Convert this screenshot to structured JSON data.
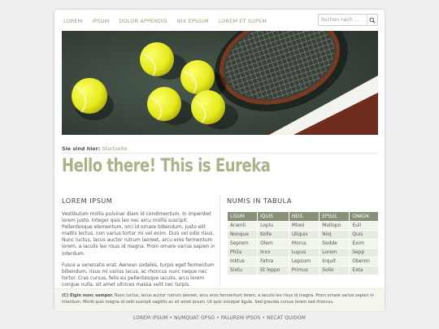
{
  "nav": {
    "items": [
      "LOREM",
      "IPSUM",
      "DOLOR APPENDIS",
      "NIX EPSIUM",
      "LOREM ET SUPEM"
    ]
  },
  "search": {
    "placeholder": "Suchen nach ..."
  },
  "breadcrumb": {
    "prefix": "Sie sind hier:",
    "current": "Startseite"
  },
  "headline": "Hello there! This is Eureka",
  "left": {
    "title": "LOREM IPSUM",
    "paragraphs": [
      "Vestibulum mollis pulvinar diam id condimentum. In imperdiet lorem justo. Integer quis leo nec arcu mollis suscipit. Pellentesque elementum, orci id ornare bibendum, justo elit mattis lectus, non varius tortor mi vel enim. Duis vel odio risus. Nunc luctus, lacus auctor rutrum laoreet, arcu eros fermentum lorem, a iaculis leo risus id magna. Proin ornare varius sapien in interdum.",
      "Fusce a venenatis erat. Aenean sodales, turpis eget fermentum bibendum, risus mi varius lacus, ac rhoncus nunc neque nec tortor. Cras cursus, felis eu pellentesque iaculis, arcu lorem congue nulla, sit amet ultrices massa velit nec turpis."
    ]
  },
  "right": {
    "title": "NUMIS IN TABULA",
    "headers": [
      "LISUM",
      "IQUIS",
      "NEIS",
      "EPSUL",
      "ONKOK"
    ],
    "rows": [
      [
        "Aramli",
        "Loplu",
        "Mlooi",
        "Mollopo",
        "Euli"
      ],
      [
        "Nonque",
        "Kolle",
        "Uliquis",
        "Niiq",
        "Quis"
      ],
      [
        "Seprem",
        "Olem",
        "Morus",
        "Sedde",
        "Exim"
      ],
      [
        "Phila",
        "Inxx",
        "Lupus",
        "Lorem",
        "Sepp"
      ],
      [
        "Inktus",
        "Fahra",
        "Lepsum",
        "Inquit",
        "Oberon"
      ],
      [
        "Sixtu",
        "Et loppo",
        "Primus",
        "Sollo",
        "Exta"
      ]
    ]
  },
  "footer": {
    "copyright": "(C) Elgin nunc semper.",
    "text": " Nunc luctus, lacus auctor rutrum laoreet, arcu eros fermentum lorem, a iaculis leo risus id magna. Proin ornare varius sapien in interdum. Morbi quis magna id velit suscipit sagittis ac sit amet ipsum. Ut quis volutpat ligule. Sed gravida cursus lorem sed rhoncus."
  },
  "bottom_links": [
    "LOREM IPSUM",
    "NUMQUAT OPSO",
    "PALUREM IPSOS",
    "NECAT QUIDOM"
  ],
  "colors": {
    "accent": "#97a27a",
    "headline": "#a9b38a",
    "table_header": "#89907a"
  }
}
